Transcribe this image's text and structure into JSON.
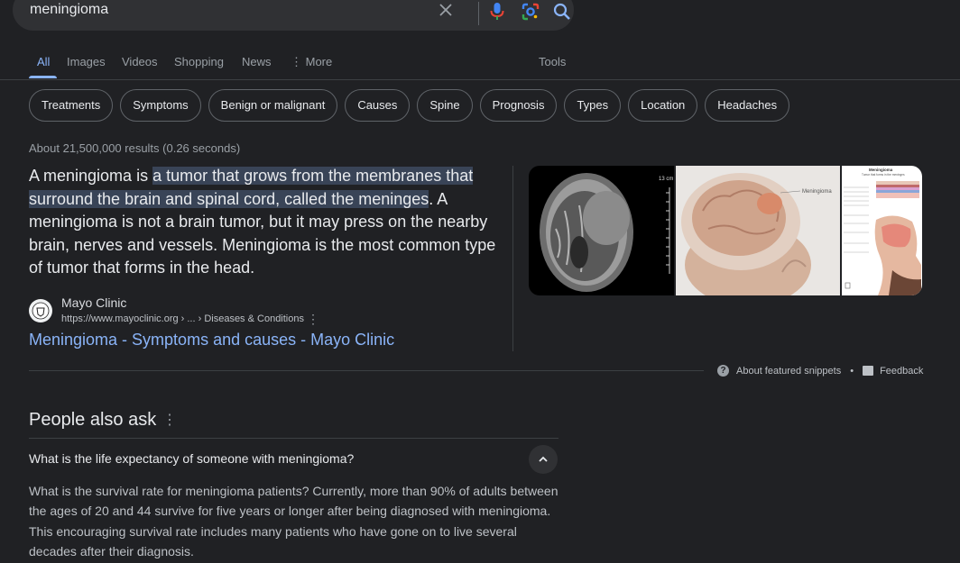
{
  "search": {
    "query": "meningioma"
  },
  "tabs": [
    {
      "label": "All",
      "active": true
    },
    {
      "label": "Images"
    },
    {
      "label": "Videos"
    },
    {
      "label": "Shopping"
    },
    {
      "label": "News"
    },
    {
      "label": "More"
    },
    {
      "label": "Tools"
    }
  ],
  "chips": [
    "Treatments",
    "Symptoms",
    "Benign or malignant",
    "Causes",
    "Spine",
    "Prognosis",
    "Types",
    "Location",
    "Headaches"
  ],
  "stats": "About 21,500,000 results (0.26 seconds)",
  "snippet": {
    "intro": "A meningioma is ",
    "highlight": "a tumor that grows from the membranes that surround the brain and spinal cord, called the meninges",
    "rest": ". A meningioma is not a brain tumor, but it may press on the nearby brain, nerves and vessels. Meningioma is the most common type of tumor that forms in the head."
  },
  "source": {
    "name": "Mayo Clinic",
    "url": "https://www.mayoclinic.org › ... › Diseases & Conditions",
    "link_text": "Meningioma - Symptoms and causes - Mayo Clinic"
  },
  "images": {
    "scan_label": "13 cm",
    "illus_label": "Meningioma",
    "diagram_title": "Meningioma",
    "diagram_subtitle": "Tumor that forms in the meninges"
  },
  "footer": {
    "about": "About featured snippets",
    "feedback": "Feedback"
  },
  "paa": {
    "title": "People also ask",
    "question": "What is the life expectancy of someone with meningioma?",
    "answer": "What is the survival rate for meningioma patients? Currently, more than 90% of adults between the ages of 20 and 44 survive for five years or longer after being diagnosed with meningioma. This encouraging survival rate includes many patients who have gone on to live several decades after their diagnosis."
  },
  "colors": {
    "background": "#202124",
    "link": "#8ab4f8",
    "highlight": "#394457"
  }
}
